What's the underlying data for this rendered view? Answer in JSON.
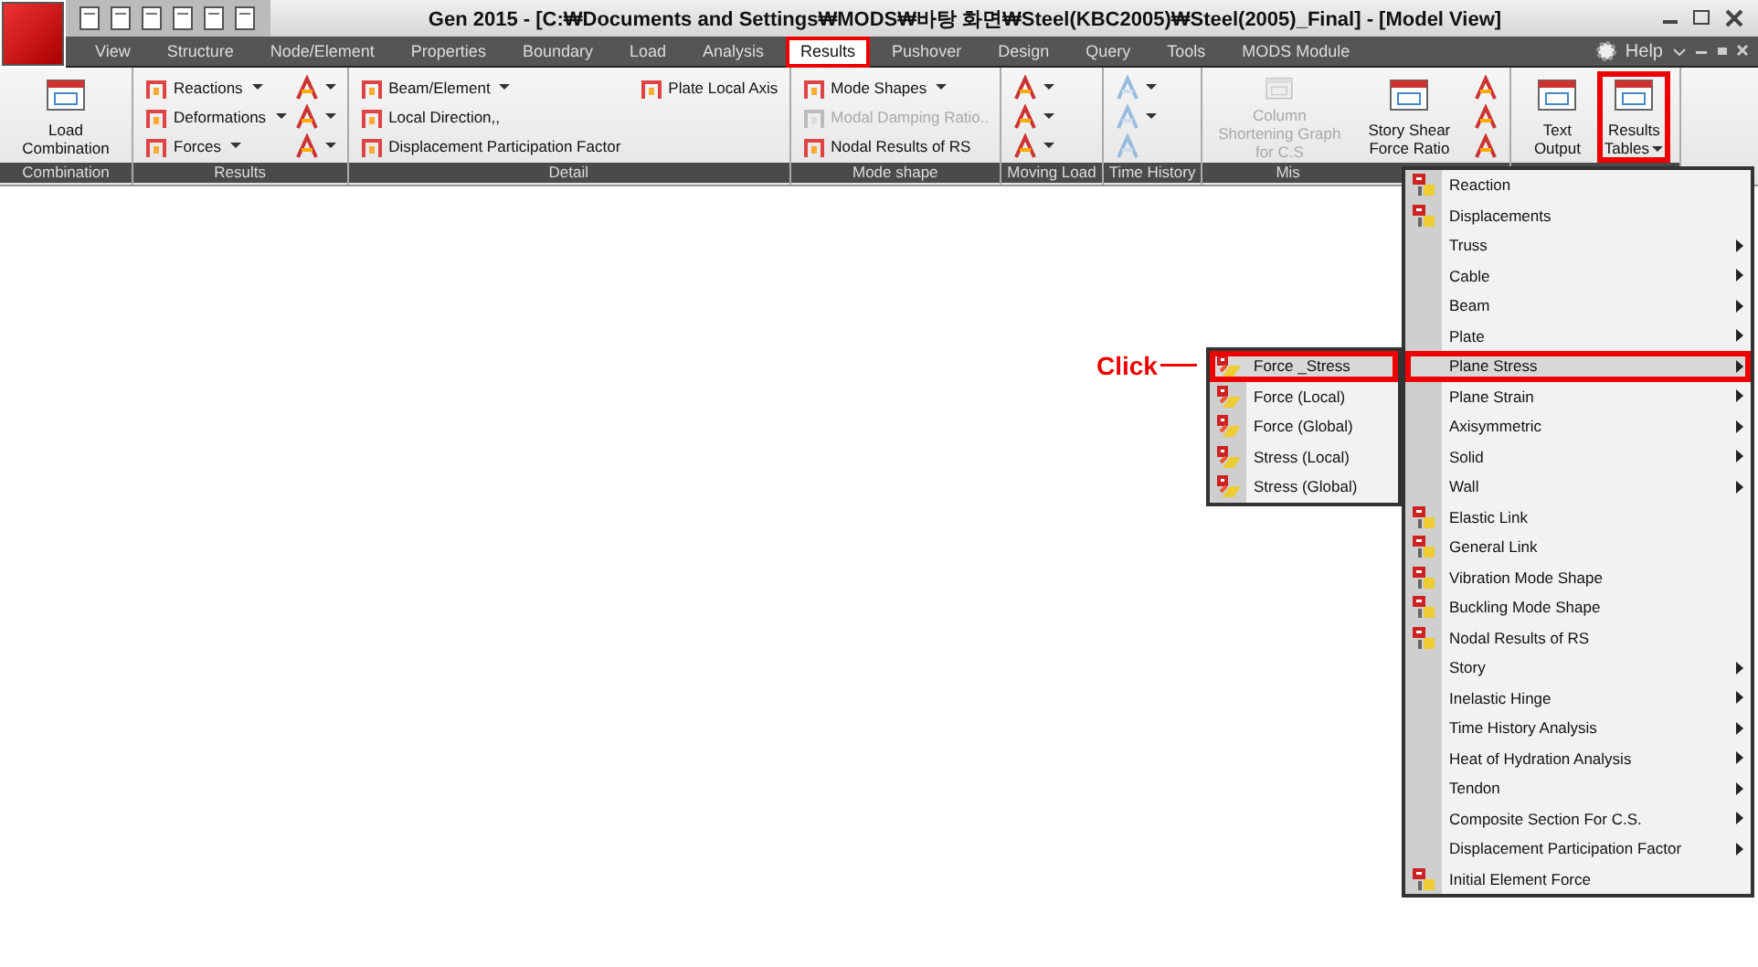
{
  "window": {
    "title": "Gen 2015 - [C:₩Documents and Settings₩MODS₩바탕 화면₩Steel(KBC2005)₩Steel(2005)_Final] - [Model View]"
  },
  "tabs": [
    {
      "label": "View",
      "selected": false
    },
    {
      "label": "Structure",
      "selected": false
    },
    {
      "label": "Node/Element",
      "selected": false
    },
    {
      "label": "Properties",
      "selected": false
    },
    {
      "label": "Boundary",
      "selected": false
    },
    {
      "label": "Load",
      "selected": false
    },
    {
      "label": "Analysis",
      "selected": false
    },
    {
      "label": "Results",
      "selected": true
    },
    {
      "label": "Pushover",
      "selected": false
    },
    {
      "label": "Design",
      "selected": false
    },
    {
      "label": "Query",
      "selected": false
    },
    {
      "label": "Tools",
      "selected": false
    },
    {
      "label": "MODS Module",
      "selected": false
    }
  ],
  "help": {
    "label": "Help"
  },
  "ribbon": [
    {
      "label": "Combination",
      "items": [
        {
          "kind": "large",
          "label": "Load Combination",
          "disabled": false,
          "dropdown": false,
          "highlighted": false
        }
      ]
    },
    {
      "label": "Results",
      "items": [
        {
          "kind": "small",
          "label": "Reactions",
          "disabled": false,
          "dropdown": true
        },
        {
          "kind": "small",
          "label": "Deformations",
          "disabled": false,
          "dropdown": true
        },
        {
          "kind": "small",
          "label": "Forces",
          "disabled": false,
          "dropdown": true
        },
        {
          "kind": "icon",
          "disabled": false,
          "dropdown": true
        },
        {
          "kind": "icon",
          "disabled": false,
          "dropdown": true
        },
        {
          "kind": "icon",
          "disabled": false,
          "dropdown": true
        }
      ]
    },
    {
      "label": "Detail",
      "items": [
        {
          "kind": "small",
          "label": "Beam/Element",
          "disabled": false,
          "dropdown": true
        },
        {
          "kind": "small",
          "label": "Local Direction,,",
          "disabled": false,
          "dropdown": false
        },
        {
          "kind": "small",
          "label": "Displacement Participation Factor",
          "disabled": false,
          "dropdown": false
        },
        {
          "kind": "small",
          "label": "Plate Local Axis",
          "disabled": false,
          "dropdown": false
        }
      ]
    },
    {
      "label": "Mode shape",
      "items": [
        {
          "kind": "small",
          "label": "Mode Shapes",
          "disabled": false,
          "dropdown": true
        },
        {
          "kind": "small",
          "label": "Modal Damping Ratio..",
          "disabled": true,
          "dropdown": false
        },
        {
          "kind": "small",
          "label": "Nodal Results of RS",
          "disabled": false,
          "dropdown": false
        }
      ]
    },
    {
      "label": "Moving Load",
      "items": [
        {
          "kind": "icon",
          "disabled": false,
          "dropdown": true
        },
        {
          "kind": "icon",
          "disabled": false,
          "dropdown": true
        },
        {
          "kind": "icon",
          "disabled": false,
          "dropdown": true
        }
      ]
    },
    {
      "label": "Time History",
      "items": [
        {
          "kind": "icon",
          "disabled": true,
          "dropdown": true
        },
        {
          "kind": "icon",
          "disabled": true,
          "dropdown": true
        },
        {
          "kind": "icon",
          "disabled": true,
          "dropdown": false
        }
      ]
    },
    {
      "label": "Mis",
      "items": [
        {
          "kind": "large",
          "label": "Column Shortening Graph for C.S",
          "disabled": true,
          "dropdown": false,
          "highlighted": false
        },
        {
          "kind": "large",
          "label": "Story Shear Force Ratio",
          "disabled": false,
          "dropdown": false,
          "highlighted": false
        },
        {
          "kind": "icon",
          "disabled": false,
          "dropdown": false
        },
        {
          "kind": "icon",
          "disabled": false,
          "dropdown": false
        },
        {
          "kind": "icon",
          "disabled": false,
          "dropdown": false
        }
      ]
    },
    {
      "items": [
        {
          "kind": "large",
          "label": "Text Output",
          "disabled": false,
          "dropdown": false,
          "highlighted": false
        },
        {
          "kind": "large",
          "label": "Results Tables",
          "disabled": false,
          "dropdown": true,
          "highlighted": true
        }
      ]
    }
  ],
  "results_menu": [
    {
      "label": "Reaction",
      "kind": "icon",
      "selected": false
    },
    {
      "label": "Displacements",
      "kind": "icon",
      "selected": false
    },
    {
      "label": "Truss",
      "kind": "submenu",
      "selected": false
    },
    {
      "label": "Cable",
      "kind": "submenu",
      "selected": false
    },
    {
      "label": "Beam",
      "kind": "submenu",
      "selected": false
    },
    {
      "label": "Plate",
      "kind": "submenu",
      "selected": false
    },
    {
      "label": "Plane Stress",
      "kind": "submenu",
      "selected": true
    },
    {
      "label": "Plane Strain",
      "kind": "submenu",
      "selected": false
    },
    {
      "label": "Axisymmetric",
      "kind": "submenu",
      "selected": false
    },
    {
      "label": "Solid",
      "kind": "submenu",
      "selected": false
    },
    {
      "label": "Wall",
      "kind": "submenu",
      "selected": false
    },
    {
      "label": "Elastic Link",
      "kind": "icon",
      "selected": false
    },
    {
      "label": "General Link",
      "kind": "icon",
      "selected": false
    },
    {
      "label": "Vibration Mode Shape",
      "kind": "icon",
      "selected": false
    },
    {
      "label": "Buckling Mode Shape",
      "kind": "icon",
      "selected": false
    },
    {
      "label": "Nodal Results of RS",
      "kind": "icon",
      "selected": false
    },
    {
      "label": "Story",
      "kind": "submenu",
      "selected": false
    },
    {
      "label": "Inelastic Hinge",
      "kind": "submenu",
      "selected": false
    },
    {
      "label": "Time History Analysis",
      "kind": "submenu",
      "selected": false
    },
    {
      "label": "Heat of Hydration Analysis",
      "kind": "submenu",
      "selected": false
    },
    {
      "label": "Tendon",
      "kind": "submenu",
      "selected": false
    },
    {
      "label": "Composite Section For C.S.",
      "kind": "submenu",
      "selected": false
    },
    {
      "label": "Displacement Participation Factor",
      "kind": "submenu",
      "selected": false
    },
    {
      "label": "Initial Element Force",
      "kind": "icon",
      "selected": false
    }
  ],
  "plane_stress_menu": [
    {
      "label": "Force _Stress",
      "selected": true
    },
    {
      "label": "Force (Local)",
      "selected": false
    },
    {
      "label": "Force (Global)",
      "selected": false
    },
    {
      "label": "Stress (Local)",
      "selected": false
    },
    {
      "label": "Stress (Global)",
      "selected": false
    }
  ],
  "annotation": {
    "label": "Click"
  }
}
